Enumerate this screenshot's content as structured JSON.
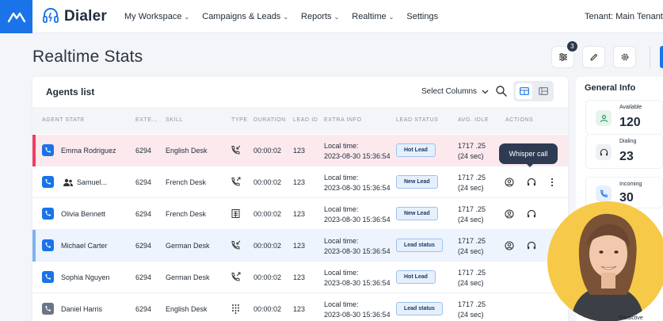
{
  "app": {
    "brand": "Dialer",
    "tenant": "Tenant: Main Tenant"
  },
  "nav": {
    "items": [
      {
        "label": "My Workspace",
        "caret": true
      },
      {
        "label": "Campaigns & Leads",
        "caret": true
      },
      {
        "label": "Reports",
        "caret": true
      },
      {
        "label": "Realtime",
        "caret": true
      },
      {
        "label": "Settings",
        "caret": false
      }
    ]
  },
  "page": {
    "title": "Realtime Stats",
    "filter_badge": "3"
  },
  "agents": {
    "title": "Agents list",
    "select_columns": "Select Columns",
    "columns": {
      "agent_state": "AGENT STATE",
      "ext": "EXTE...",
      "skill": "SKILL",
      "type": "TYPE",
      "duration": "DURATION",
      "lead_id": "LEAD ID",
      "extra_info": "EXTRA INFO",
      "lead_status": "LEAD STATUS",
      "avg_idle": "AVG. IDLE",
      "actions": "ACTIONS"
    },
    "rows": [
      {
        "name": "Emma Rodriguez",
        "ext": "6294",
        "skill": "English Desk",
        "type_icon": "phone-incoming-icon",
        "duration": "00:00:02",
        "lead_id": "123",
        "extra_label": "Local time:",
        "extra_time": "2023-08-30 15:36:54",
        "status": "Hot Lead",
        "idle_value": "1717 .25",
        "idle_sec": "(24 sec)"
      },
      {
        "name": "Samuel...",
        "ext": "6294",
        "skill": "French Desk",
        "type_icon": "phone-outgoing-icon",
        "duration": "00:00:02",
        "lead_id": "123",
        "extra_label": "Local time:",
        "extra_time": "2023-08-30 15:36:54",
        "status": "New Lead",
        "idle_value": "1717 .25",
        "idle_sec": "(24 sec)"
      },
      {
        "name": "Olivia Bennett",
        "ext": "6294",
        "skill": "French Desk",
        "type_icon": "building-icon",
        "duration": "00:00:02",
        "lead_id": "123",
        "extra_label": "Local time:",
        "extra_time": "2023-08-30 15:36:54",
        "status": "New Lead",
        "idle_value": "1717 .25",
        "idle_sec": "(24 sec)"
      },
      {
        "name": "Michael Carter",
        "ext": "6294",
        "skill": "German Desk",
        "type_icon": "phone-incoming-icon",
        "duration": "00:00:02",
        "lead_id": "123",
        "extra_label": "Local time:",
        "extra_time": "2023-08-30 15:36:54",
        "status": "Lead status",
        "idle_value": "1717 .25",
        "idle_sec": "(24 sec)"
      },
      {
        "name": "Sophia Nguyen",
        "ext": "6294",
        "skill": "German Desk",
        "type_icon": "phone-outgoing-icon",
        "duration": "00:00:02",
        "lead_id": "123",
        "extra_label": "Local time:",
        "extra_time": "2023-08-30 15:36:54",
        "status": "Hot Lead",
        "idle_value": "1717 .25",
        "idle_sec": "(24 sec)"
      },
      {
        "name": "Daniel Harris",
        "ext": "6294",
        "skill": "English Desk",
        "type_icon": "dialpad-icon",
        "duration": "00:00:02",
        "lead_id": "123",
        "extra_label": "Local time:",
        "extra_time": "2023-08-30 15:36:54",
        "status": "Lead status",
        "idle_value": "1717 .25",
        "idle_sec": "(24 sec)"
      }
    ],
    "tooltip": "Whisper call"
  },
  "info": {
    "title": "General Info",
    "stats": [
      {
        "label": "Available",
        "value": "120"
      },
      {
        "label": "Dialing",
        "value": "23"
      },
      {
        "label": "Incoming",
        "value": "30"
      }
    ],
    "predictive_label": "Predictive"
  },
  "colors": {
    "accent": "#1a73e8",
    "row_hot": "#fce9ee",
    "row_selected": "#eef4fd",
    "stripe_hot": "#ef3e62",
    "stripe_selected": "#7fb2f0",
    "available": "#2e9d6a",
    "tooltip": "#2f3b52",
    "avatar_bg": "#f7c948"
  }
}
